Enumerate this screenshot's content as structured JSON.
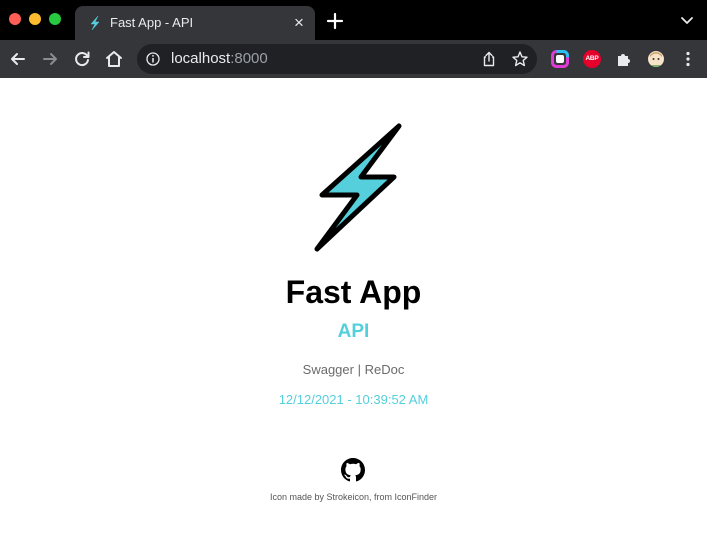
{
  "browser": {
    "tab": {
      "title": "Fast App - API",
      "close_icon": "×"
    },
    "new_tab_icon": "plus-icon",
    "address": {
      "host": "localhost",
      "port": ":8000"
    },
    "extensions": {
      "abp_label": "ABP"
    }
  },
  "page": {
    "title": "Fast App",
    "subtitle": "API",
    "link_swagger": "Swagger",
    "link_separator": " | ",
    "link_redoc": "ReDoc",
    "datetime": "12/12/2021 - 10:39:52 AM",
    "credit_prefix": "Icon made by ",
    "credit_author": "Strokeicon",
    "credit_middle": ", from ",
    "credit_source": "IconFinder"
  },
  "colors": {
    "accent": "#54cfdb",
    "tab_bg": "#35363a",
    "titlebar_bg": "#000000"
  }
}
